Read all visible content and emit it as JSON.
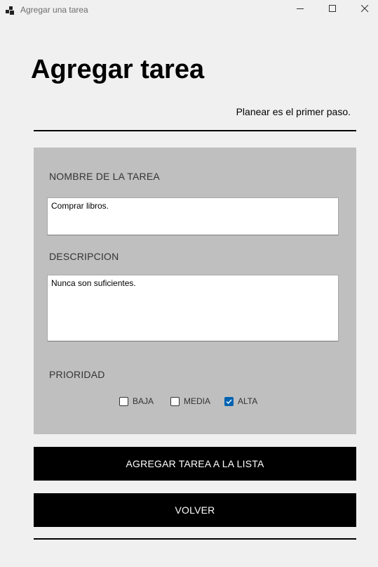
{
  "window": {
    "title": "Agregar una tarea",
    "icon": "app-icon",
    "controls": [
      "minimize-icon",
      "maximize-icon",
      "close-icon"
    ]
  },
  "header": {
    "title": "Agregar tarea",
    "subtitle": "Planear es el primer paso."
  },
  "form": {
    "name_label": "NOMBRE DE LA TAREA",
    "name_value": "Comprar libros.",
    "description_label": "DESCRIPCION",
    "description_value": "Nunca son suficientes.",
    "priority_label": "PRIORIDAD",
    "priorities": [
      {
        "label": "BAJA",
        "checked": false
      },
      {
        "label": "MEDIA",
        "checked": false
      },
      {
        "label": "ALTA",
        "checked": true
      }
    ]
  },
  "actions": {
    "add_label": "AGREGAR TAREA A LA LISTA",
    "back_label": "VOLVER"
  },
  "colors": {
    "background": "#f0f0f0",
    "panel": "#bfbfbf",
    "button": "#000000",
    "button_text": "#ffffff",
    "checkbox_checked": "#0063b1"
  }
}
